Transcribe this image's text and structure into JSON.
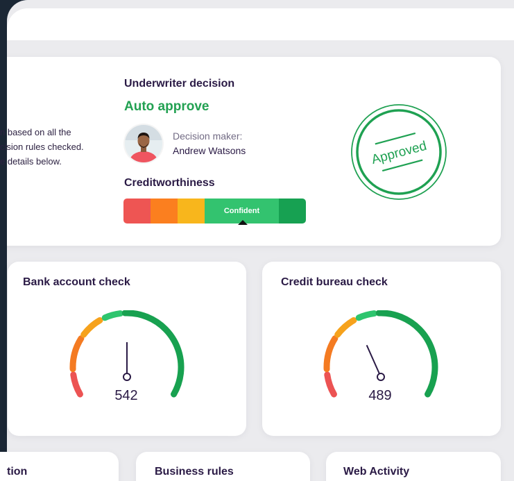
{
  "summary": {
    "lines": [
      "n based on all the",
      "cision rules checked.",
      "e details below."
    ]
  },
  "underwriter": {
    "title": "Underwriter decision",
    "decision": "Auto approve",
    "maker_label": "Decision maker:",
    "maker_name": "Andrew Watsons"
  },
  "creditworthiness": {
    "title": "Creditworthiness",
    "active_label": "Confident",
    "segment_colors": [
      "#ee5553",
      "#fb7f1f",
      "#f8b61c",
      "#33c36f",
      "#17a152"
    ],
    "active_index": 3
  },
  "stamp": {
    "text": "Approved",
    "color": "#1fa152"
  },
  "gauges": [
    {
      "title": "Bank account check",
      "value": "542",
      "level": 0.5
    },
    {
      "title": "Credit bureau check",
      "value": "489",
      "level": 0.4
    }
  ],
  "gauge_colors": [
    "#ec5353",
    "#f6a21c",
    "#f5b821",
    "#2ec56e",
    "#18a150"
  ],
  "bottom_cards": [
    {
      "title": "tion"
    },
    {
      "title": "Business rules"
    },
    {
      "title": "Web Activity"
    }
  ]
}
